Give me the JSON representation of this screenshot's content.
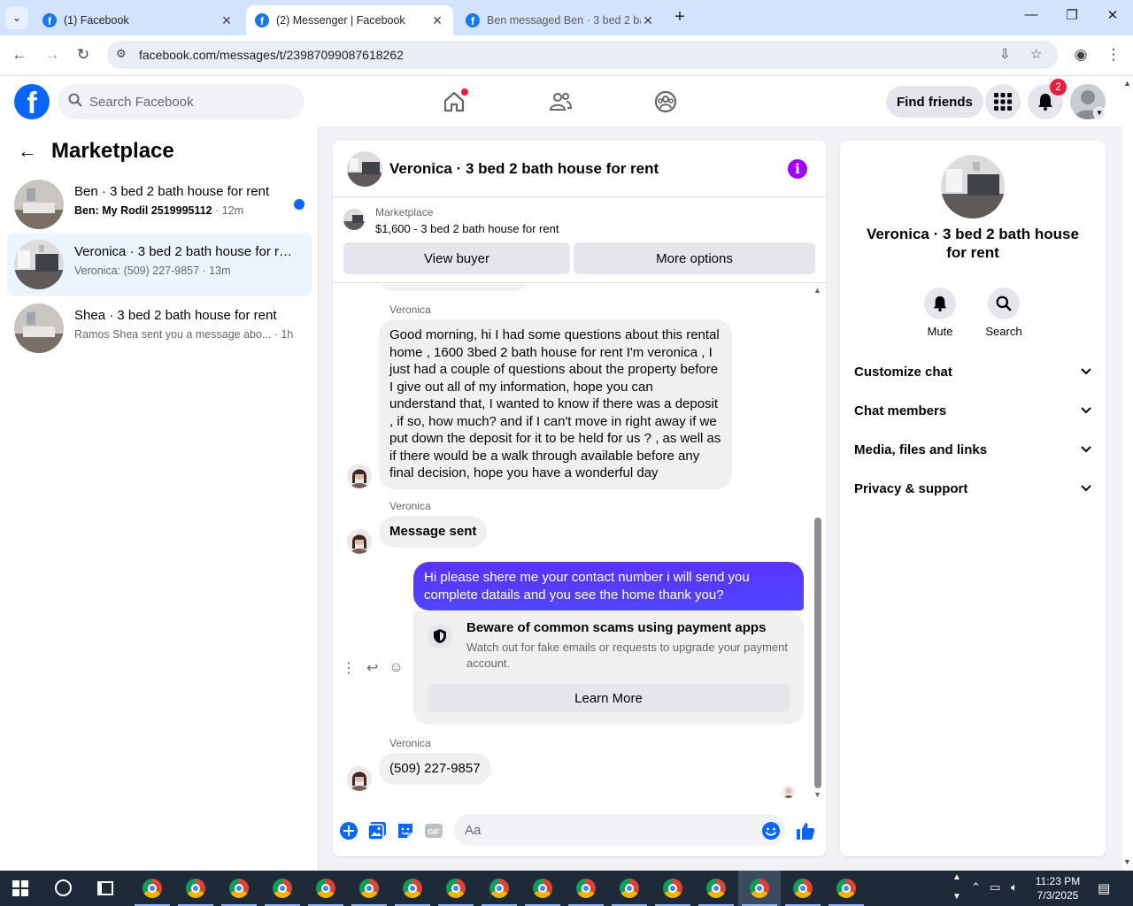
{
  "browser": {
    "tabs": [
      {
        "title": "(1) Facebook"
      },
      {
        "title": "(2) Messenger | Facebook"
      },
      {
        "title": "Ben messaged Ben · 3 bed 2 ba"
      }
    ],
    "url": "facebook.com/messages/t/23987099087618262"
  },
  "fb_nav": {
    "logo_letter": "f",
    "search_placeholder": "Search Facebook",
    "find_friends_label": "Find friends",
    "notification_count": "2"
  },
  "sidebar": {
    "title": "Marketplace",
    "conversations": [
      {
        "name": "Ben · 3 bed 2 bath house for rent",
        "preview": "Ben: My Rodil 2519995112",
        "time": " · 12m",
        "unread": true
      },
      {
        "name": "Veronica · 3 bed 2 bath house for rent",
        "preview": "Veronica: (509) 227-9857",
        "time": " · 13m",
        "unread": false
      },
      {
        "name": "Shea · 3 bed 2 bath house for rent",
        "preview": "Ramos Shea sent you a message abo...",
        "time": " · 1h",
        "unread": false
      }
    ]
  },
  "chat": {
    "title": "Veronica · 3 bed 2 bath house for rent",
    "marketplace_label": "Marketplace",
    "listing": "$1,600 - 3 bed 2 bath house for rent",
    "view_buyer_label": "View buyer",
    "more_options_label": "More options",
    "messages": [
      {
        "sender": "Veronica",
        "text": "Good morning, hi I had some questions about this rental home , 1600 3bed 2 bath house for rent I'm veronica  , I just had a couple of questions about the property before I give out all of my information,  hope you can understand that, I wanted to know if there was a deposit , if so, how much? and if I can't move in right away if we put down the deposit for it to be held for us ? , as well as if there would be a walk through available before any final decision,  hope you have a wonderful day"
      },
      {
        "sender": "Veronica",
        "text": "Message sent"
      },
      {
        "sender": "me",
        "text": "Hi please shere me your contact number i will send you complete datails and you see the home thank you?"
      },
      {
        "sender": "Veronica",
        "text": "(509) 227-9857"
      }
    ],
    "scam_notice": {
      "title": "Beware of common scams using payment apps",
      "body": "Watch out for fake emails or requests to upgrade your payment account.",
      "button": "Learn More"
    },
    "composer_placeholder": "Aa",
    "gif_label": "GIF"
  },
  "info_panel": {
    "name": "Veronica · 3 bed 2 bath house for rent",
    "actions": [
      {
        "label": "Mute"
      },
      {
        "label": "Search"
      }
    ],
    "sections": [
      "Customize chat",
      "Chat members",
      "Media, files and links",
      "Privacy & support"
    ]
  },
  "taskbar": {
    "time": "11:23 PM",
    "date": "7/3/2025"
  },
  "colors": {
    "fb_blue": "#0866ff",
    "outgoing_bubble": "#5b3bff",
    "active_conversation": "#ebf5ff",
    "info_icon": "#a100ff",
    "badge_red": "#e41e3f"
  }
}
